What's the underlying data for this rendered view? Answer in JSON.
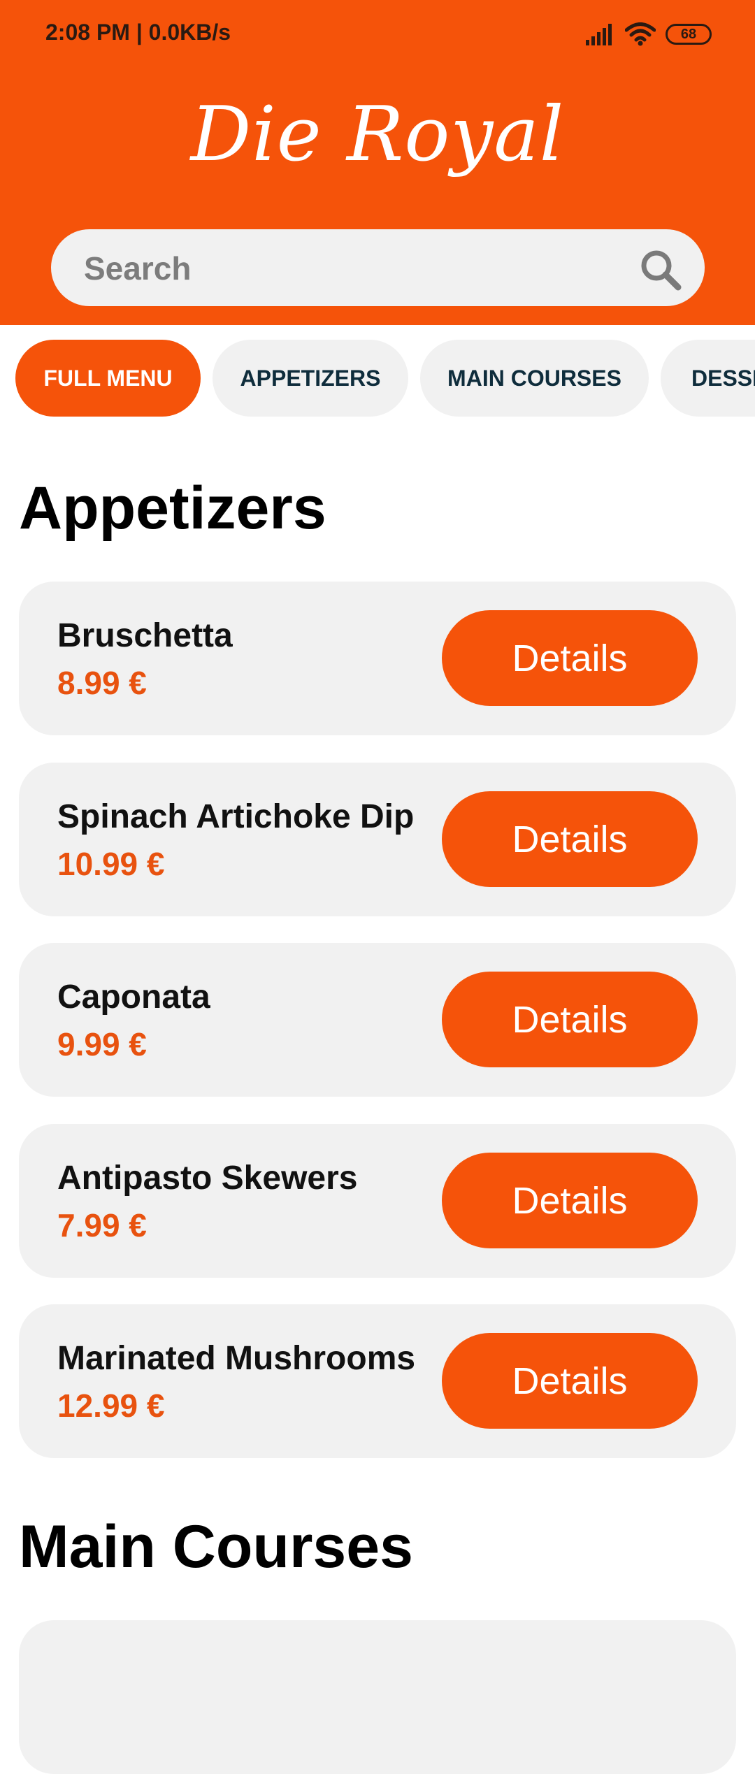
{
  "status_bar": {
    "time": "2:08 PM | 0.0KB/s",
    "battery": "68"
  },
  "header": {
    "title": "Die Royal",
    "search_placeholder": "Search"
  },
  "colors": {
    "accent": "#f5530a",
    "card_bg": "#f1f1f1",
    "chip_text": "#0f2d3c"
  },
  "categories": [
    {
      "label": "FULL MENU",
      "active": true
    },
    {
      "label": "APPETIZERS",
      "active": false
    },
    {
      "label": "MAIN COURSES",
      "active": false
    },
    {
      "label": "DESSERTS",
      "active": false
    }
  ],
  "sections": [
    {
      "title": "Appetizers",
      "items": [
        {
          "name": "Bruschetta",
          "price": "8.99 €",
          "button": "Details"
        },
        {
          "name": "Spinach Artichoke Dip",
          "price": "10.99 €",
          "button": "Details"
        },
        {
          "name": "Caponata",
          "price": "9.99 €",
          "button": "Details"
        },
        {
          "name": "Antipasto Skewers",
          "price": "7.99 €",
          "button": "Details"
        },
        {
          "name": "Marinated Mushrooms",
          "price": "12.99 €",
          "button": "Details"
        }
      ]
    },
    {
      "title": "Main Courses",
      "items": []
    }
  ]
}
